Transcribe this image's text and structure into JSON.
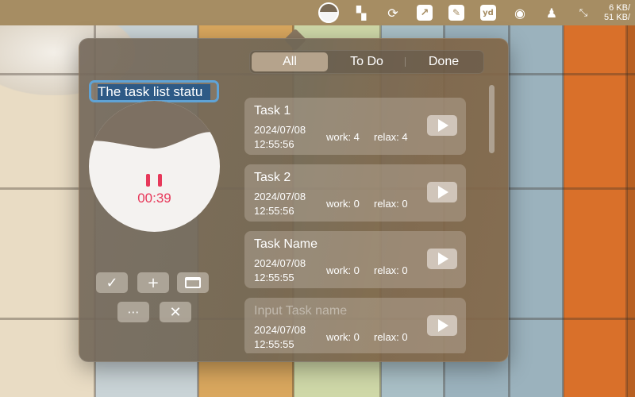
{
  "menubar": {
    "icons": [
      "task-timer-icon",
      "panels-icon",
      "sync-icon",
      "chart-icon",
      "edit-icon",
      "youdao-icon",
      "wechat-icon",
      "qq-penguin-icon",
      "arrows-icon"
    ],
    "youdao_label": "yd",
    "net_up": "6 KB/",
    "net_down": "51 KB/"
  },
  "left_panel": {
    "title_field_value": "The task list statu",
    "timer": "00:39"
  },
  "segments": [
    {
      "label": "All",
      "active": true
    },
    {
      "label": "To Do",
      "active": false
    },
    {
      "label": "Done",
      "active": false
    }
  ],
  "tasks": [
    {
      "name": "Task 1",
      "date": "2024/07/08",
      "time": "12:55:56",
      "work": "work: 4",
      "relax": "relax: 4"
    },
    {
      "name": "Task 2",
      "date": "2024/07/08",
      "time": "12:55:56",
      "work": "work: 0",
      "relax": "relax: 0"
    },
    {
      "name": "Task Name",
      "date": "2024/07/08",
      "time": "12:55:55",
      "work": "work: 0",
      "relax": "relax: 0"
    },
    {
      "name_placeholder": "Input Task name",
      "date": "2024/07/08",
      "time": "12:55:55",
      "work": "work: 0",
      "relax": "relax: 0"
    }
  ],
  "colors": {
    "accent_red": "#e7385a",
    "focus_blue": "#5fa3d6",
    "menubar": "#a68d63"
  }
}
